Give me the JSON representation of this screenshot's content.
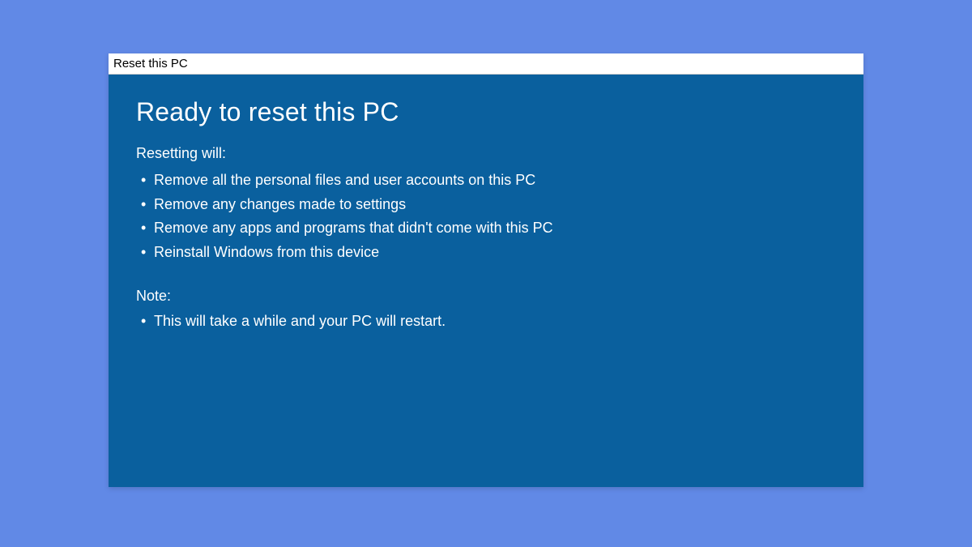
{
  "window": {
    "title": "Reset this PC"
  },
  "main": {
    "heading": "Ready to reset this PC",
    "resetting_label": "Resetting will:",
    "resetting_items": [
      "Remove all the personal files and user accounts on this PC",
      "Remove any changes made to settings",
      "Remove any apps and programs that didn't come with this PC",
      "Reinstall Windows from this device"
    ],
    "note_label": "Note:",
    "note_items": [
      "This will take a while and your PC will restart."
    ]
  },
  "colors": {
    "page_bg": "#6189e6",
    "panel_bg": "#0a609e",
    "titlebar_bg": "#ffffff",
    "text_light": "#ffffff",
    "text_dark": "#000000"
  }
}
